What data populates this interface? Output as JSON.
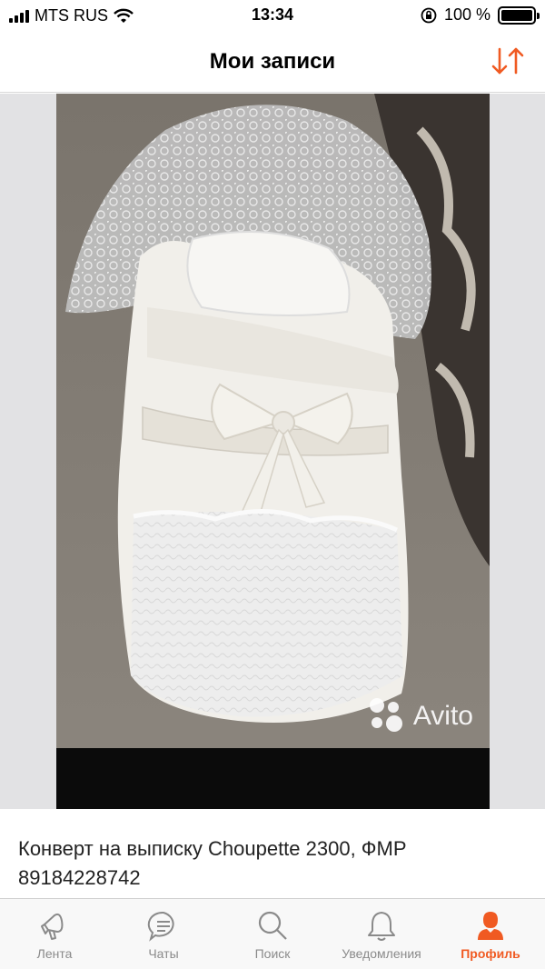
{
  "status_bar": {
    "carrier": "MTS RUS",
    "time": "13:34",
    "battery": "100 %"
  },
  "header": {
    "title": "Мои записи",
    "sort_icon": "sort-arrows-icon"
  },
  "listing": {
    "watermark": "Avito",
    "title": "Конверт на выписку Choupette 2300, ФМР 89184228742"
  },
  "tabbar": {
    "items": [
      {
        "label": "Лента",
        "icon": "megaphone-icon"
      },
      {
        "label": "Чаты",
        "icon": "chat-bubble-icon"
      },
      {
        "label": "Поиск",
        "icon": "search-icon"
      },
      {
        "label": "Уведомления",
        "icon": "bell-icon"
      },
      {
        "label": "Профиль",
        "icon": "profile-icon",
        "active": true
      }
    ]
  },
  "colors": {
    "accent": "#f05a22",
    "inactive": "#8a8a8a"
  }
}
